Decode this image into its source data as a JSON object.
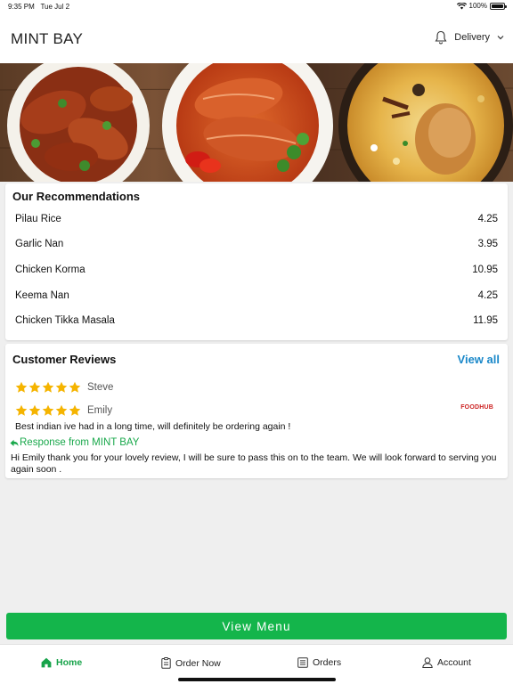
{
  "status_bar": {
    "time": "9:35 PM",
    "date": "Tue Jul 2",
    "battery": "100%",
    "wifi_icon": "wifi-icon",
    "battery_icon": "battery-icon"
  },
  "header": {
    "brand": "MINT BAY",
    "mode_label": "Delivery",
    "bell_icon": "bell-icon",
    "dropdown_icon": "chevron-down-icon"
  },
  "hero": {
    "dishes": [
      "chicken-dish",
      "fish-curry-dish",
      "biryani-dish"
    ]
  },
  "recommendations": {
    "title": "Our Recommendations",
    "items": [
      {
        "name": "Pilau Rice",
        "price": "4.25"
      },
      {
        "name": "Garlic Nan",
        "price": "3.95"
      },
      {
        "name": "Chicken Korma",
        "price": "10.95"
      },
      {
        "name": "Keema Nan",
        "price": "4.25"
      },
      {
        "name": "Chicken Tikka Masala",
        "price": "11.95"
      }
    ]
  },
  "reviews": {
    "title": "Customer Reviews",
    "view_all": "View all",
    "source_logo": "FOODHUB",
    "items": [
      {
        "name": "Steve",
        "rating": 5
      },
      {
        "name": "Emily",
        "rating": 5,
        "text": "Best indian ive had in a long time, will definitely be ordering again !"
      }
    ],
    "response": {
      "heading": "Response from MINT BAY",
      "text": "Hi Emily thank you for your lovely review, I will be sure to pass this on to the team. We will look forward to serving you again soon ."
    }
  },
  "view_menu": "View Menu",
  "tabs": [
    {
      "label": "Home",
      "icon": "home-icon",
      "active": true
    },
    {
      "label": "Order Now",
      "icon": "order-icon",
      "active": false
    },
    {
      "label": "Orders",
      "icon": "orders-icon",
      "active": false
    },
    {
      "label": "Account",
      "icon": "account-icon",
      "active": false
    }
  ],
  "colors": {
    "accent_green": "#14b54b",
    "link_blue": "#1a88c9",
    "star_gold": "#f5b400",
    "foodhub_red": "#cc2222"
  }
}
